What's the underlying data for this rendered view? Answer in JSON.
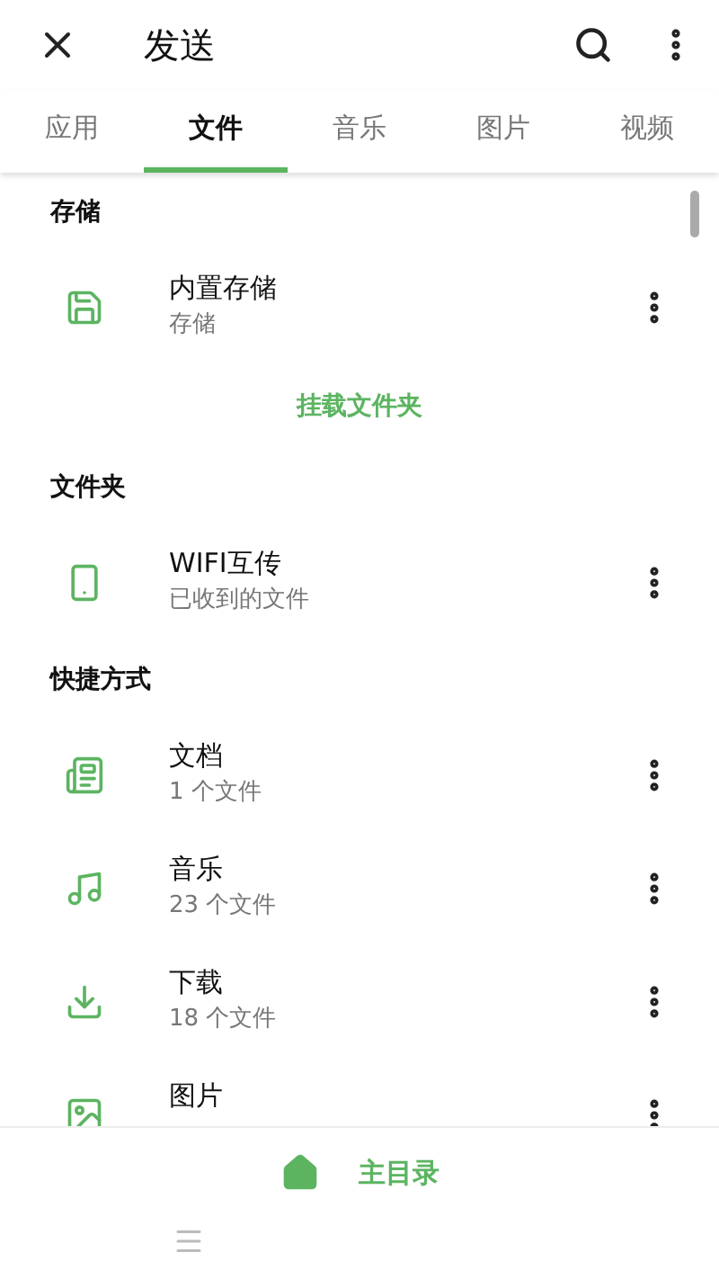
{
  "app_bar": {
    "title": "发送"
  },
  "tabs": [
    {
      "label": "应用",
      "selected": false
    },
    {
      "label": "文件",
      "selected": true
    },
    {
      "label": "音乐",
      "selected": false
    },
    {
      "label": "图片",
      "selected": false
    },
    {
      "label": "视频",
      "selected": false
    }
  ],
  "sections": [
    {
      "kind": "header",
      "title": "存储"
    },
    {
      "kind": "item",
      "title": "内置存储",
      "subtitle": "存储"
    },
    {
      "kind": "action",
      "title": "挂载文件夹"
    },
    {
      "kind": "header",
      "title": "文件夹"
    },
    {
      "kind": "item",
      "title": "WIFI互传",
      "subtitle": "已收到的文件"
    },
    {
      "kind": "header",
      "title": "快捷方式"
    },
    {
      "kind": "item",
      "title": "文档",
      "subtitle": "1 个文件"
    },
    {
      "kind": "item",
      "title": "音乐",
      "subtitle": "23 个文件"
    },
    {
      "kind": "item",
      "title": "下载",
      "subtitle": "18 个文件"
    },
    {
      "kind": "item",
      "title": "图片"
    }
  ],
  "bottom_bar": {
    "label": "主目录"
  }
}
